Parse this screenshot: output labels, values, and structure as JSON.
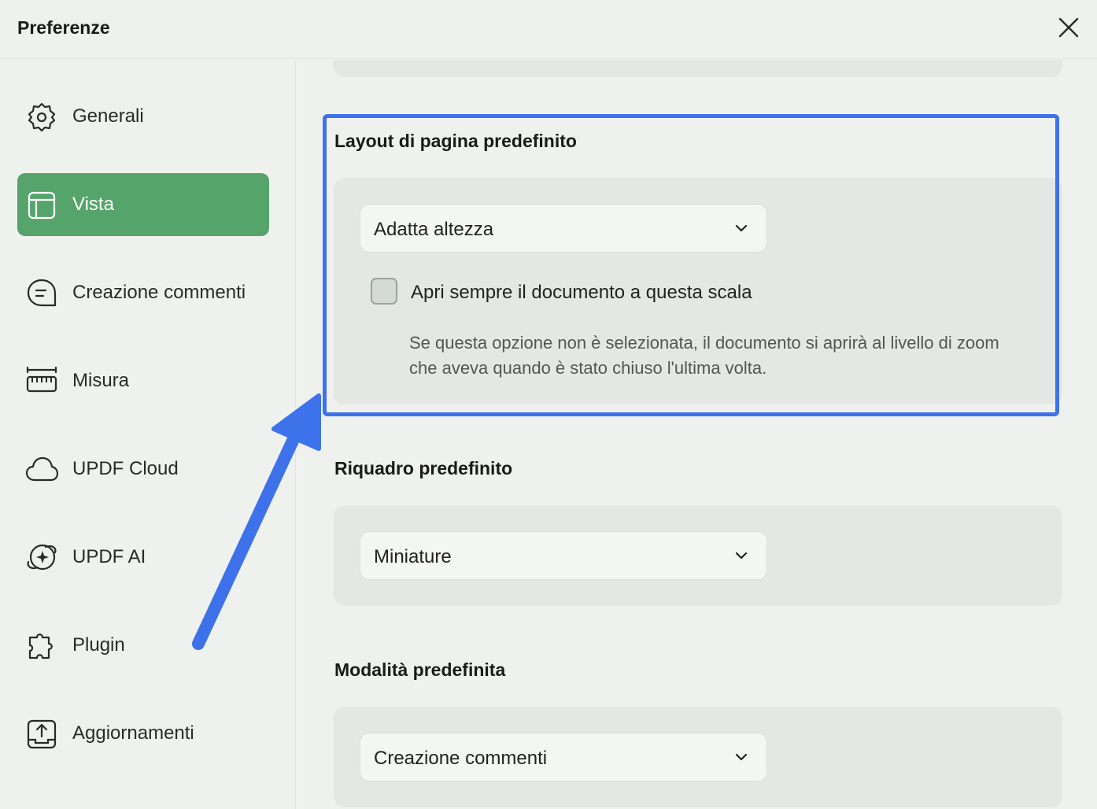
{
  "window": {
    "title": "Preferenze"
  },
  "sidebar": {
    "items": [
      {
        "label": "Generali",
        "icon": "gear-icon"
      },
      {
        "label": "Vista",
        "icon": "layout-icon",
        "active": true
      },
      {
        "label": "Creazione commenti",
        "icon": "comment-icon"
      },
      {
        "label": "Misura",
        "icon": "ruler-icon"
      },
      {
        "label": "UPDF Cloud",
        "icon": "cloud-icon"
      },
      {
        "label": "UPDF AI",
        "icon": "ai-sparkle-icon"
      },
      {
        "label": "Plugin",
        "icon": "puzzle-icon"
      },
      {
        "label": "Aggiornamenti",
        "icon": "update-icon"
      }
    ]
  },
  "sections": {
    "page_layout": {
      "title": "Layout di pagina predefinito",
      "selected": "Adatta altezza",
      "checkbox_label": "Apri sempre il documento a questa scala",
      "checkbox_checked": false,
      "hint": "Se questa opzione non è selezionata, il documento si aprirà al livello di zoom che aveva quando è stato chiuso l'ultima volta."
    },
    "default_panel": {
      "title": "Riquadro predefinito",
      "selected": "Miniature"
    },
    "default_mode": {
      "title": "Modalità predefinita",
      "selected": "Creazione commenti"
    }
  },
  "colors": {
    "accent": "#55a46c",
    "highlight": "#3d72eb",
    "background": "#eff1ee",
    "card": "#e5e7e4"
  }
}
